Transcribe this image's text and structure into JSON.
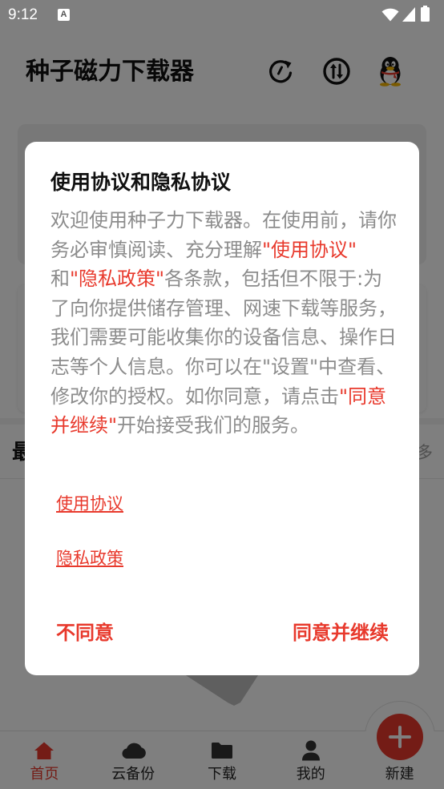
{
  "status_bar": {
    "time": "9:12",
    "notification_glyph": "A",
    "icons": [
      "notification-icon",
      "wifi-icon",
      "signal-icon",
      "battery-icon"
    ]
  },
  "app_bar": {
    "title": "种子磁力下载器",
    "actions": [
      {
        "icon": "refresh-icon"
      },
      {
        "icon": "transfer-icon"
      },
      {
        "icon": "qq-icon"
      }
    ]
  },
  "list_section": {
    "title_fragment": "最",
    "more_fragment": "多"
  },
  "bottom_nav": {
    "items": [
      {
        "label": "首页",
        "icon": "home-icon",
        "active": true
      },
      {
        "label": "云备份",
        "icon": "cloud-icon",
        "active": false
      },
      {
        "label": "下载",
        "icon": "folder-icon",
        "active": false
      },
      {
        "label": "我的",
        "icon": "person-icon",
        "active": false
      }
    ],
    "fab": {
      "label": "新建",
      "icon": "plus-icon"
    }
  },
  "dialog": {
    "title": "使用协议和隐私协议",
    "body": [
      {
        "text": "欢迎使用种子力下载器。在使用前，请你务必审慎阅读、充分理解",
        "emphasis": false
      },
      {
        "text": "\"使用协议\"",
        "emphasis": true
      },
      {
        "text": " 和",
        "emphasis": false
      },
      {
        "text": "\"隐私政策\"",
        "emphasis": true
      },
      {
        "text": "各条款，包括但不限于:为了向你提供储存管理、网速下载等服务，我们需要可能收集你的设备信息、操作日志等个人信息。你可以在\"设置\"中查看、修改你的授权。如你同意，请点击",
        "emphasis": false
      },
      {
        "text": "\"同意并继续\"",
        "emphasis": true
      },
      {
        "text": "开始接受我们的服务。",
        "emphasis": false
      }
    ],
    "links": [
      {
        "label": "使用协议"
      },
      {
        "label": "隐私政策"
      }
    ],
    "buttons": {
      "decline": "不同意",
      "accept": "同意并继续"
    }
  },
  "colors": {
    "accent": "#e8392c",
    "dialog_body_text": "#8c8c8c",
    "dim_overlay": "rgba(0,0,0,0.5)"
  }
}
